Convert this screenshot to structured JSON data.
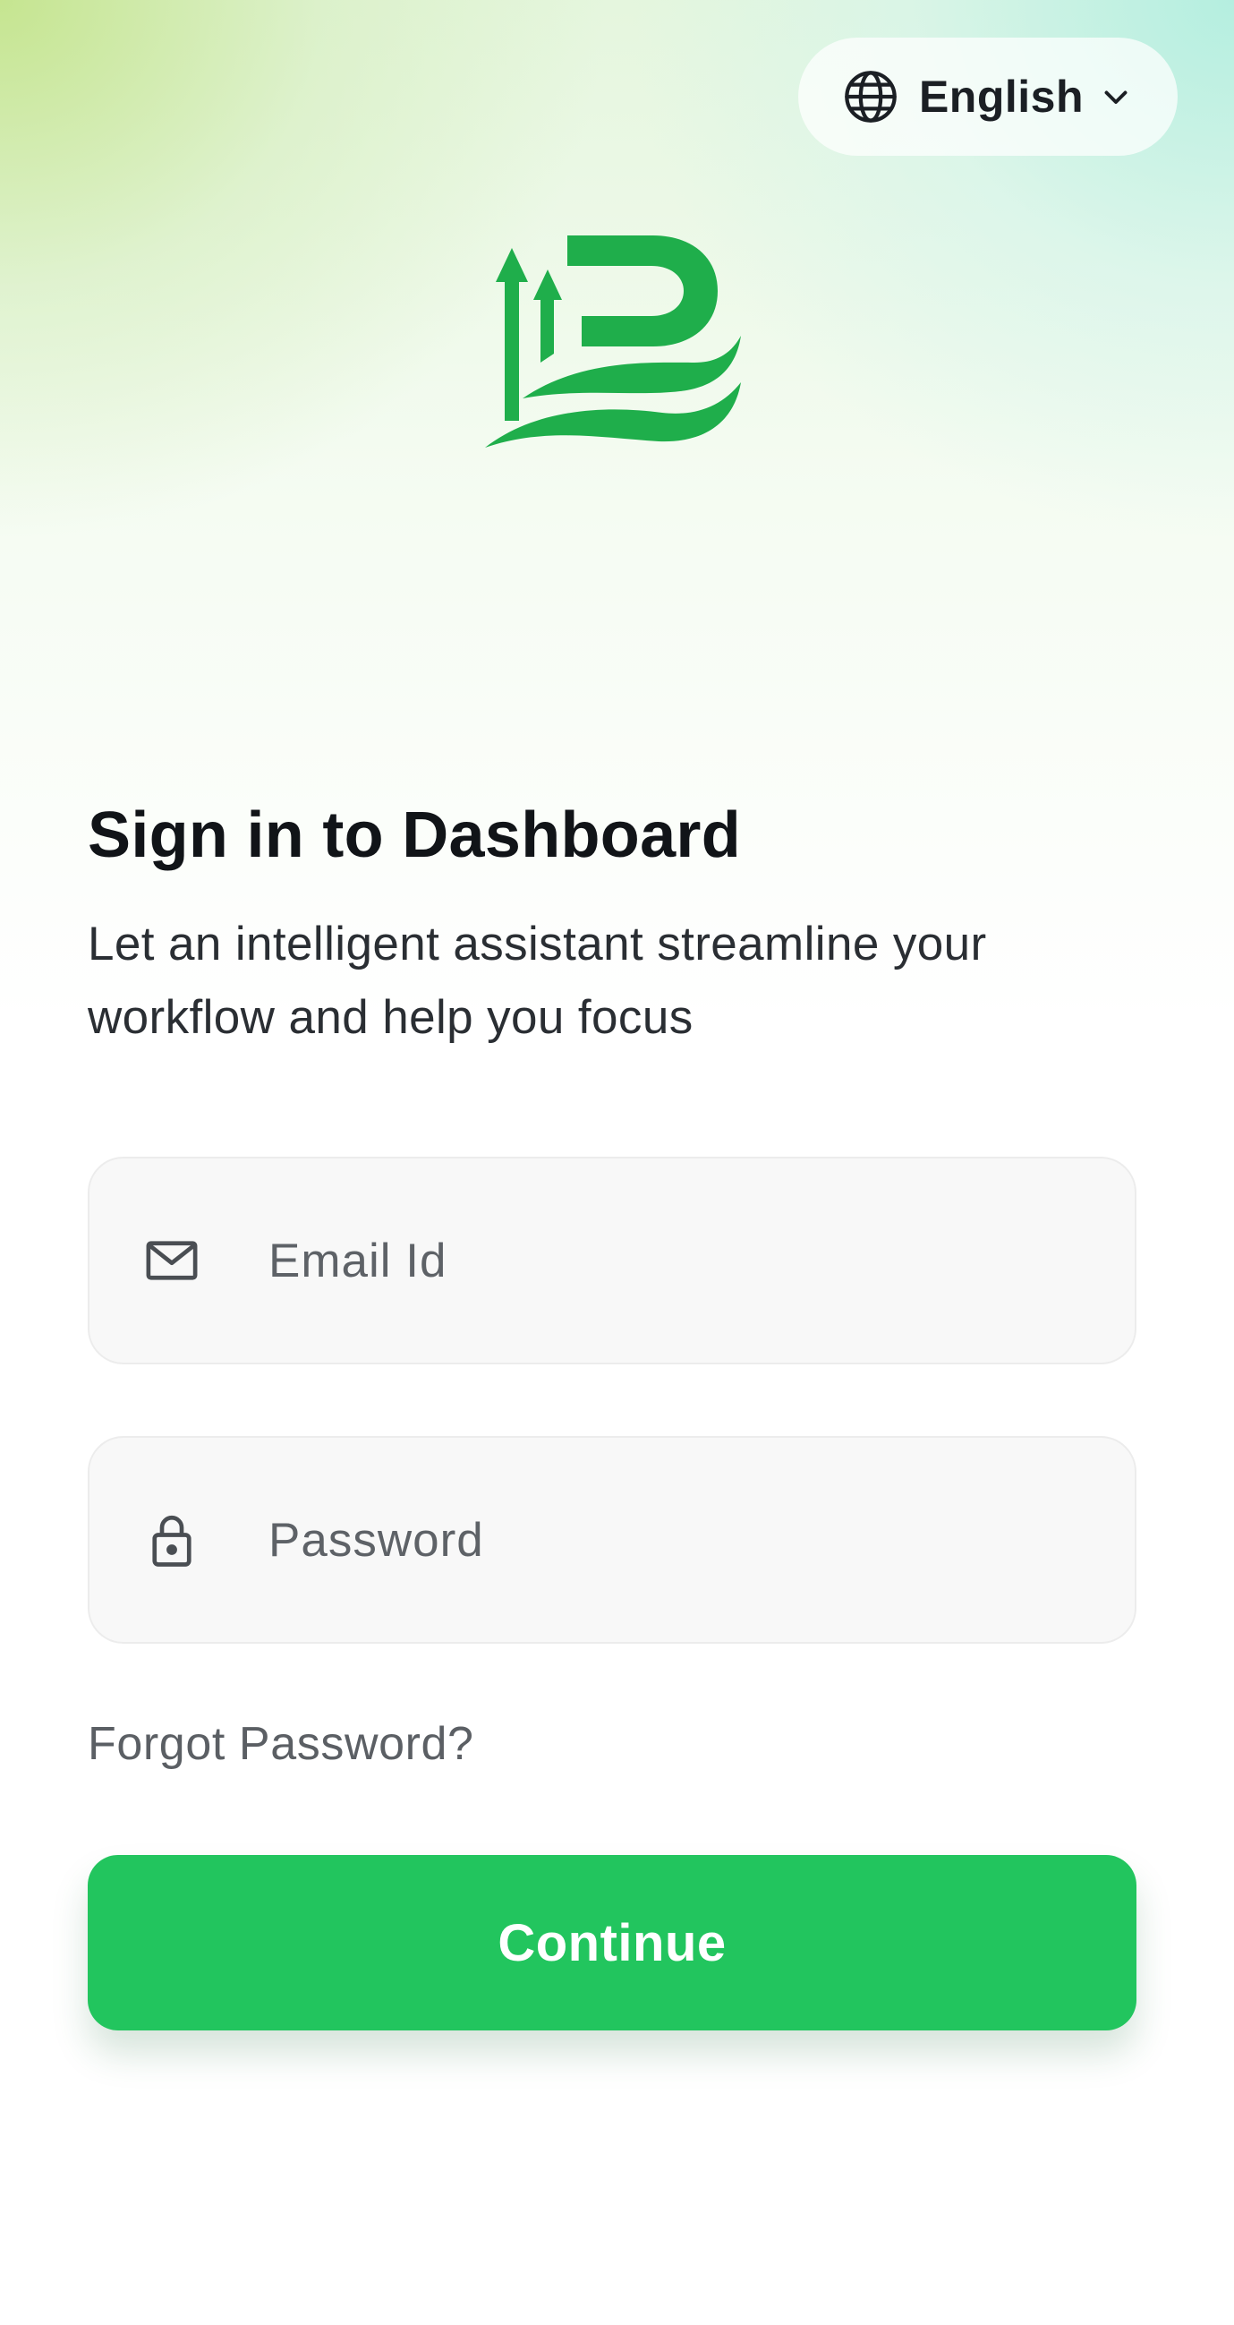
{
  "language_selector": {
    "label": "English",
    "icon": "globe-icon",
    "chevron_icon": "chevron-down-icon"
  },
  "logo": {
    "icon": "brand-logo",
    "color": "#1fae4b"
  },
  "header": {
    "title": "Sign in to Dashboard",
    "subtitle": "Let an intelligent assistant streamline your workflow and help you focus"
  },
  "form": {
    "email": {
      "placeholder": "Email Id",
      "value": "",
      "icon": "mail-icon"
    },
    "password": {
      "placeholder": "Password",
      "value": "",
      "icon": "lock-icon"
    },
    "forgot_password_label": "Forgot Password?",
    "continue_label": "Continue"
  },
  "colors": {
    "accent": "#22c55e",
    "text_primary": "#111418",
    "text_secondary": "#5b5f64",
    "field_bg": "#f8f8f8"
  }
}
